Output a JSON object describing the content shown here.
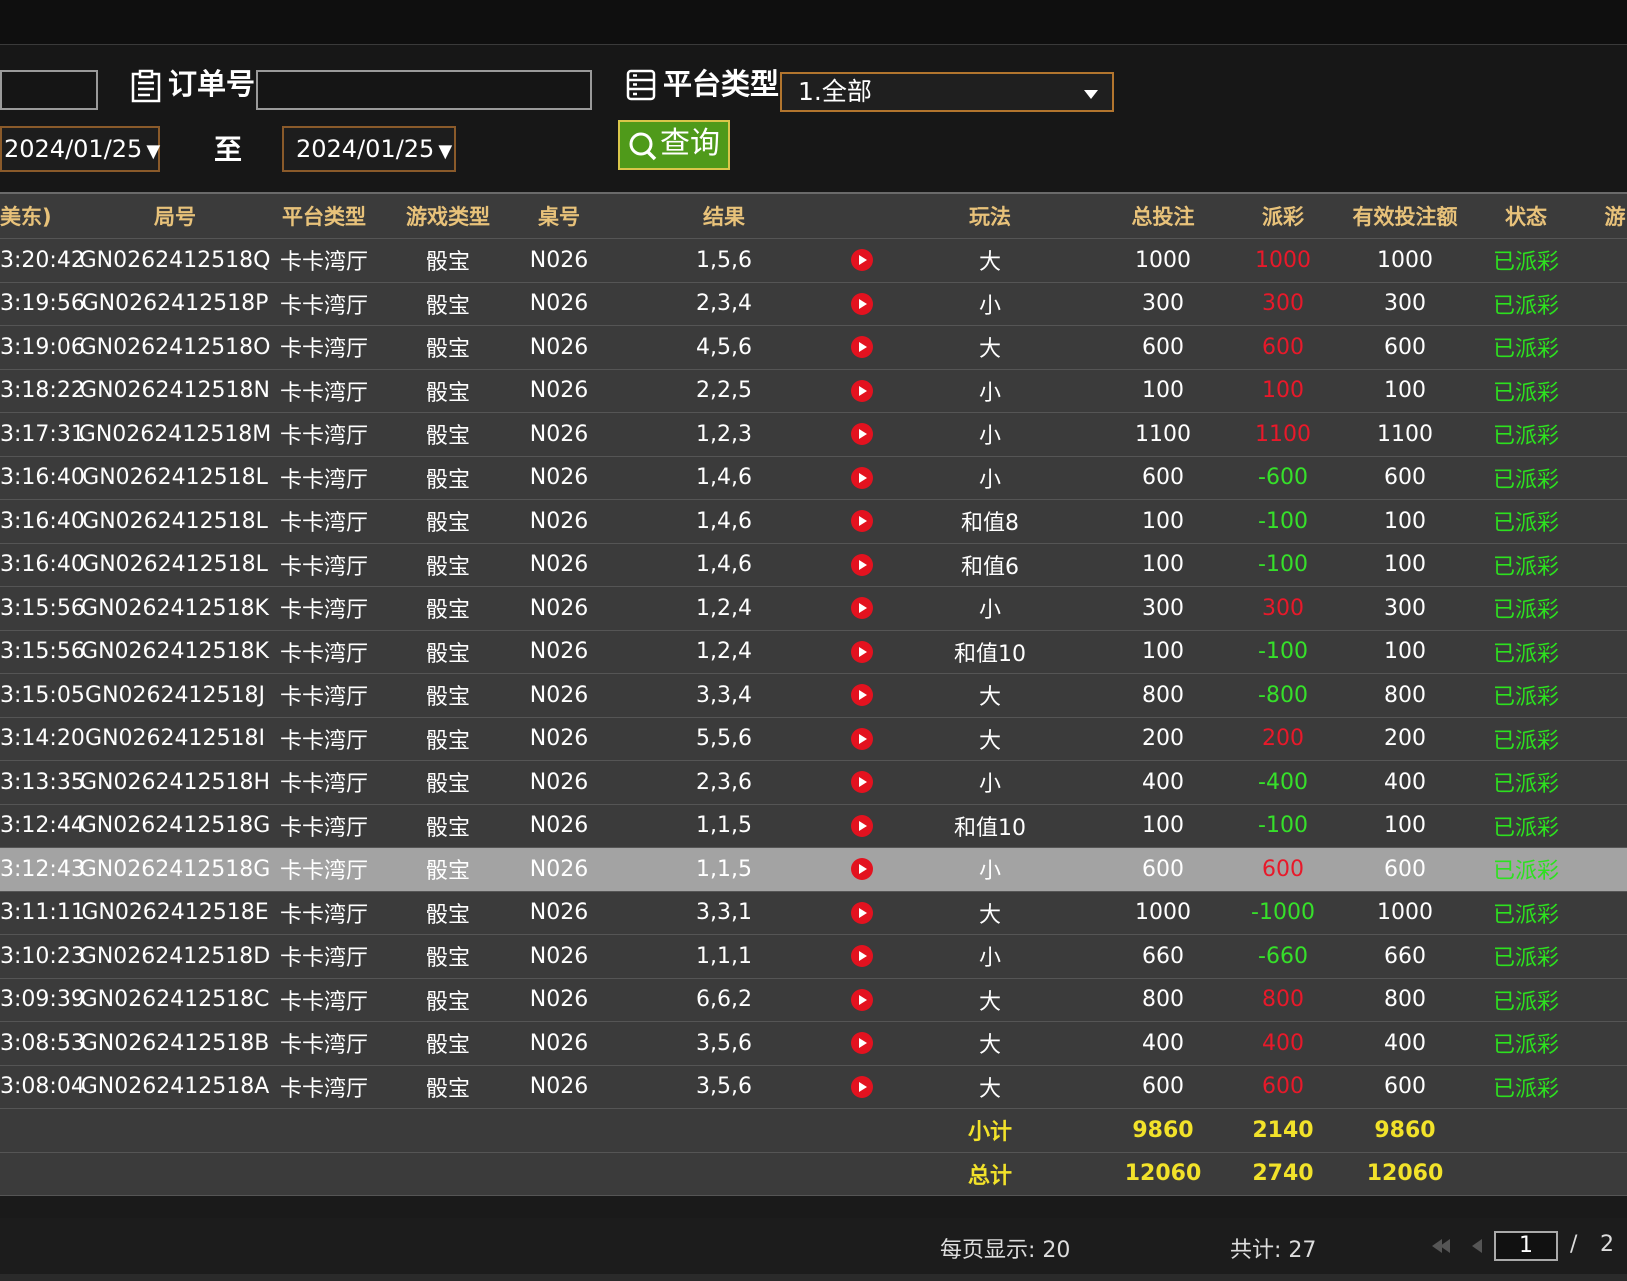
{
  "filters": {
    "order_label": "订单号",
    "order_value": "",
    "platform_label": "平台类型",
    "platform_value": "1.全部",
    "start_date": "2024/01/25",
    "to_label": "至",
    "end_date": "2024/01/25",
    "query_label": "查询"
  },
  "table": {
    "columns": [
      "美东)",
      "局号",
      "平台类型",
      "游戏类型",
      "桌号",
      "结果",
      "",
      "玩法",
      "总投注",
      "派彩",
      "有效投注额",
      "状态",
      "游"
    ],
    "rows": [
      [
        "3:20:42",
        "GN0262412518Q",
        "卡卡湾厅",
        "骰宝",
        "N026",
        "1,5,6",
        "大",
        "1000",
        "1000",
        "1000",
        "已派彩",
        "red"
      ],
      [
        "3:19:56",
        "GN0262412518P",
        "卡卡湾厅",
        "骰宝",
        "N026",
        "2,3,4",
        "小",
        "300",
        "300",
        "300",
        "已派彩",
        "red"
      ],
      [
        "3:19:06",
        "GN0262412518O",
        "卡卡湾厅",
        "骰宝",
        "N026",
        "4,5,6",
        "大",
        "600",
        "600",
        "600",
        "已派彩",
        "red"
      ],
      [
        "3:18:22",
        "GN0262412518N",
        "卡卡湾厅",
        "骰宝",
        "N026",
        "2,2,5",
        "小",
        "100",
        "100",
        "100",
        "已派彩",
        "red"
      ],
      [
        "3:17:31",
        "GN0262412518M",
        "卡卡湾厅",
        "骰宝",
        "N026",
        "1,2,3",
        "小",
        "1100",
        "1100",
        "1100",
        "已派彩",
        "red"
      ],
      [
        "3:16:40",
        "GN0262412518L",
        "卡卡湾厅",
        "骰宝",
        "N026",
        "1,4,6",
        "小",
        "600",
        "-600",
        "600",
        "已派彩",
        "green"
      ],
      [
        "3:16:40",
        "GN0262412518L",
        "卡卡湾厅",
        "骰宝",
        "N026",
        "1,4,6",
        "和值8",
        "100",
        "-100",
        "100",
        "已派彩",
        "green"
      ],
      [
        "3:16:40",
        "GN0262412518L",
        "卡卡湾厅",
        "骰宝",
        "N026",
        "1,4,6",
        "和值6",
        "100",
        "-100",
        "100",
        "已派彩",
        "green"
      ],
      [
        "3:15:56",
        "GN0262412518K",
        "卡卡湾厅",
        "骰宝",
        "N026",
        "1,2,4",
        "小",
        "300",
        "300",
        "300",
        "已派彩",
        "red"
      ],
      [
        "3:15:56",
        "GN0262412518K",
        "卡卡湾厅",
        "骰宝",
        "N026",
        "1,2,4",
        "和值10",
        "100",
        "-100",
        "100",
        "已派彩",
        "green"
      ],
      [
        "3:15:05",
        "GN0262412518J",
        "卡卡湾厅",
        "骰宝",
        "N026",
        "3,3,4",
        "大",
        "800",
        "-800",
        "800",
        "已派彩",
        "green"
      ],
      [
        "3:14:20",
        "GN0262412518I",
        "卡卡湾厅",
        "骰宝",
        "N026",
        "5,5,6",
        "大",
        "200",
        "200",
        "200",
        "已派彩",
        "red"
      ],
      [
        "3:13:35",
        "GN0262412518H",
        "卡卡湾厅",
        "骰宝",
        "N026",
        "2,3,6",
        "小",
        "400",
        "-400",
        "400",
        "已派彩",
        "green"
      ],
      [
        "3:12:44",
        "GN0262412518G",
        "卡卡湾厅",
        "骰宝",
        "N026",
        "1,1,5",
        "和值10",
        "100",
        "-100",
        "100",
        "已派彩",
        "green"
      ],
      [
        "3:12:43",
        "GN0262412518G",
        "卡卡湾厅",
        "骰宝",
        "N026",
        "1,1,5",
        "小",
        "600",
        "600",
        "600",
        "已派彩",
        "red"
      ],
      [
        "3:11:11",
        "GN0262412518E",
        "卡卡湾厅",
        "骰宝",
        "N026",
        "3,3,1",
        "大",
        "1000",
        "-1000",
        "1000",
        "已派彩",
        "green"
      ],
      [
        "3:10:23",
        "GN0262412518D",
        "卡卡湾厅",
        "骰宝",
        "N026",
        "1,1,1",
        "小",
        "660",
        "-660",
        "660",
        "已派彩",
        "green"
      ],
      [
        "3:09:39",
        "GN0262412518C",
        "卡卡湾厅",
        "骰宝",
        "N026",
        "6,6,2",
        "大",
        "800",
        "800",
        "800",
        "已派彩",
        "red"
      ],
      [
        "3:08:53",
        "GN0262412518B",
        "卡卡湾厅",
        "骰宝",
        "N026",
        "3,5,6",
        "大",
        "400",
        "400",
        "400",
        "已派彩",
        "red"
      ],
      [
        "3:08:04",
        "GN0262412518A",
        "卡卡湾厅",
        "骰宝",
        "N026",
        "3,5,6",
        "大",
        "600",
        "600",
        "600",
        "已派彩",
        "red"
      ]
    ],
    "selected_row": 14,
    "subtotal": {
      "label": "小计",
      "bet": "9860",
      "payout": "2140",
      "valid": "9860"
    },
    "total": {
      "label": "总计",
      "bet": "12060",
      "payout": "2740",
      "valid": "12060"
    }
  },
  "footer": {
    "per_page": "每页显示: 20",
    "total_count": "共计: 27",
    "page_value": "1",
    "page_sep": "/",
    "page_total": "2"
  },
  "colors": {
    "accent": "#e8c27a",
    "positive_payout": "#e8192a",
    "negative_payout": "#36e02a",
    "status": "#2de11f",
    "summary": "#f2e22a"
  }
}
